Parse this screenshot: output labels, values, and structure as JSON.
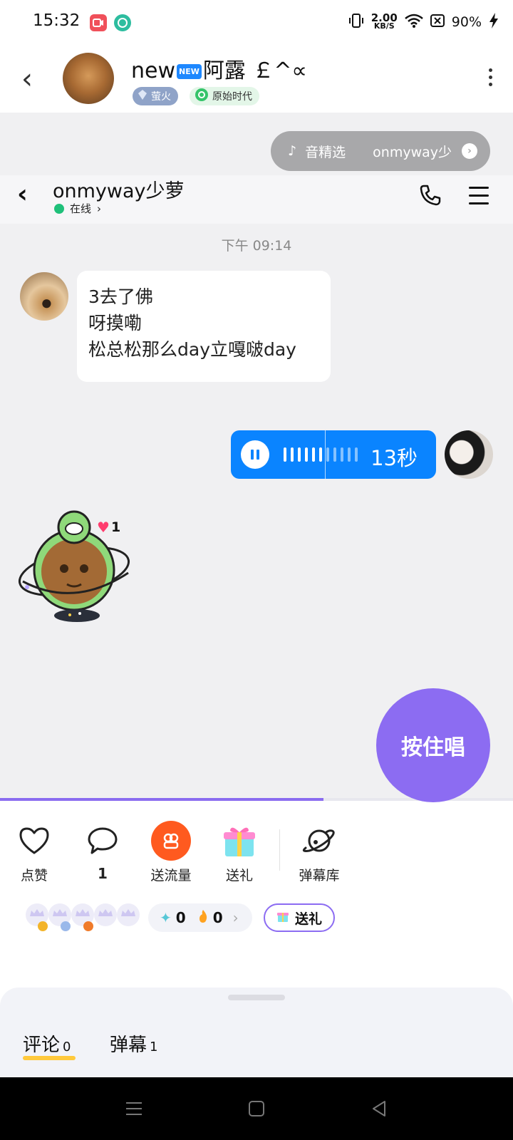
{
  "status_bar": {
    "time": "15:32",
    "speed_value": "2.00",
    "speed_unit": "KB/S",
    "battery": "90%",
    "icons": [
      "screen-record-icon",
      "chat-app-icon",
      "vibrate-icon",
      "wifi-icon",
      "sim-icon",
      "charging-icon"
    ]
  },
  "header": {
    "title_prefix": "new",
    "new_badge": "NEW",
    "title_suffix": "阿露 ￡^∝",
    "tag_firefly": "萤火",
    "tag_primitive": "原始时代"
  },
  "music": {
    "label": "音精选",
    "song": "onmyway少"
  },
  "chat": {
    "name": "onmyway少萝",
    "status": "在线",
    "timestamp": "下午 09:14",
    "message_lines": [
      "3去了佛",
      "呀摸嘞",
      "松总松那么day立嘎啵day"
    ],
    "voice_duration": "13秒",
    "sticker_likes": "1"
  },
  "progress": {
    "fraction": 0.63
  },
  "actions": {
    "like_label": "点赞",
    "comment_count": "1",
    "flow_label": "送流量",
    "gift_label": "送礼",
    "danmaku_library_label": "弹幕库"
  },
  "sing_button": "按住唱",
  "stats": {
    "diamond_count": "0",
    "fire_count": "0",
    "gift_button": "送礼"
  },
  "sheet": {
    "comment_tab": "评论",
    "comment_count": "0",
    "danmaku_tab": "弹幕",
    "danmaku_count": "1"
  },
  "colors": {
    "accent_purple": "#8c6cf2",
    "voice_blue": "#0a84ff",
    "flow_orange": "#ff5a1f",
    "online_green": "#1fc07a"
  }
}
